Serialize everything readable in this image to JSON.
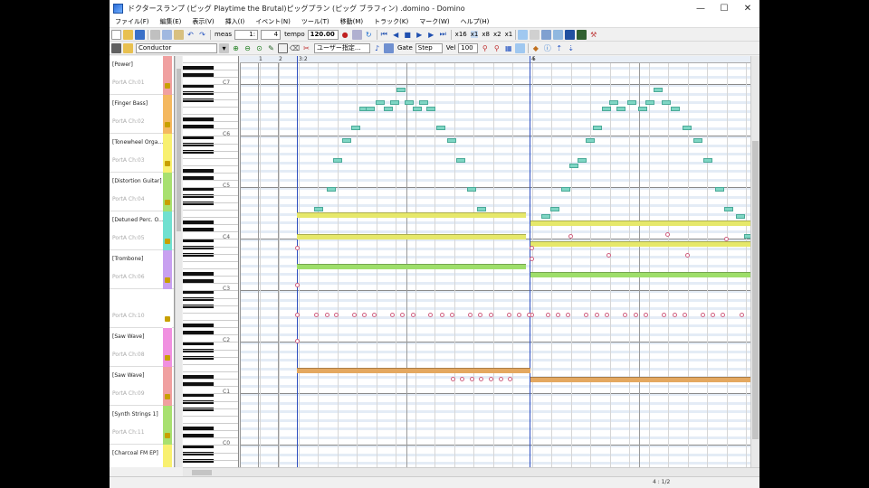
{
  "window": {
    "title": "ドクタースランプ (ピッグ Playtime the Brutal)ピッグプラン (ピッグ ブラフィン) .domino - Domino",
    "min_glyph": "—",
    "max_glyph": "☐",
    "close_glyph": "✕"
  },
  "menubar": {
    "items": [
      "ファイル(F)",
      "編集(E)",
      "表示(V)",
      "挿入(I)",
      "イベント(N)",
      "ツール(T)",
      "移動(M)",
      "トラック(K)",
      "マーク(W)",
      "ヘルプ(H)"
    ]
  },
  "toolbar1": {
    "meas_label": "meas",
    "measure_value": "1:",
    "beat_value": "4",
    "tempo_label": "tempo",
    "tempo_value": "120.00",
    "zoom_labels": [
      "x16",
      "x1",
      "x8",
      "x2",
      "x1"
    ]
  },
  "toolbar2": {
    "track_select": "Conductor",
    "user_edit": "ユーザー指定...",
    "gate_label": "Gate",
    "gate_value": "Step",
    "vel_label": "Vel",
    "vel_value": "100"
  },
  "tracks": [
    {
      "name": "[Power]",
      "port": "PortA Ch:01",
      "color": "#f0a0a0"
    },
    {
      "name": "[Finger Bass]",
      "port": "PortA Ch:02",
      "color": "#f4b860"
    },
    {
      "name": "[Tonewheel Orga...",
      "port": "PortA Ch:03",
      "color": "#f8f070"
    },
    {
      "name": "[Distortion Guitar]",
      "port": "PortA Ch:04",
      "color": "#a8e070"
    },
    {
      "name": "[Detuned Perc. O...",
      "port": "PortA Ch:05",
      "color": "#70e0d0"
    },
    {
      "name": "[Trombone]",
      "port": "PortA Ch:06",
      "color": "#c8a0f0"
    },
    {
      "name": "",
      "port": "PortA Ch:10",
      "color": "#ffffff"
    },
    {
      "name": "[Saw Wave]",
      "port": "PortA Ch:08",
      "color": "#f090e0"
    },
    {
      "name": "[Saw Wave]",
      "port": "PortA Ch:09",
      "color": "#f0a0a0"
    },
    {
      "name": "[Synth Strings 1]",
      "port": "PortA Ch:11",
      "color": "#a8e070"
    },
    {
      "name": "[Charcoal FM EP]",
      "port": "",
      "color": "#f8f070"
    }
  ],
  "keyboard": {
    "octave_labels": [
      "C7",
      "C6",
      "C5",
      "C4",
      "C3",
      "C2",
      "C1",
      "C0"
    ]
  },
  "ruler": {
    "labels": [
      "1",
      "2",
      "3:2",
      "4",
      "5"
    ]
  },
  "roll": {
    "bar_colors": {
      "yellow": "#e6e86a",
      "green": "#9ede6a",
      "orange": "#e4a860"
    },
    "note_color": "#7fd6c4"
  },
  "status": {
    "position": "4 : 1/2"
  }
}
